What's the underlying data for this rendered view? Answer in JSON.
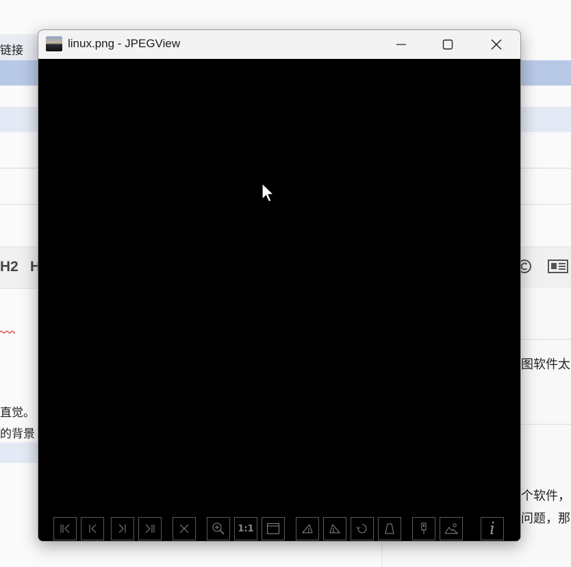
{
  "background_app": {
    "top_left_text": "链接",
    "heading_buttons": [
      "H2",
      "H"
    ],
    "left_text_lines": [
      "直觉。",
      "的背景"
    ],
    "right_text_lines": [
      "图软件太",
      "个软件，",
      "问题，那"
    ],
    "icons": [
      "copyright-icon",
      "newspaper-icon"
    ]
  },
  "viewer": {
    "title": "linux.png - JPEGView",
    "window_controls": {
      "minimize": "minimize-icon",
      "maximize": "maximize-icon",
      "close": "close-icon"
    },
    "toolbar": {
      "groups": [
        [
          {
            "name": "first-image-button",
            "icon": "skip-first-icon"
          },
          {
            "name": "previous-image-button",
            "icon": "previous-icon"
          },
          {
            "name": "next-image-button",
            "icon": "next-icon"
          },
          {
            "name": "last-image-button",
            "icon": "skip-last-icon"
          }
        ],
        [
          {
            "name": "delete-button",
            "icon": "cross-icon"
          }
        ],
        [
          {
            "name": "zoom-button",
            "icon": "zoom-in-icon"
          },
          {
            "name": "actual-size-button",
            "label": "1:1"
          },
          {
            "name": "fit-window-button",
            "icon": "window-icon"
          }
        ],
        [
          {
            "name": "rotate-clockwise-button",
            "icon": "rotate-cw-icon"
          },
          {
            "name": "rotate-counterclockwise-button",
            "icon": "rotate-ccw-icon"
          },
          {
            "name": "rotate-free-button",
            "icon": "rotate-arrow-icon"
          },
          {
            "name": "perspective-button",
            "icon": "trapezoid-icon"
          }
        ],
        [
          {
            "name": "keep-params-button",
            "icon": "pin-icon"
          },
          {
            "name": "landscape-mode-button",
            "icon": "landscape-icon"
          }
        ],
        [
          {
            "name": "info-button",
            "label": "i"
          }
        ]
      ]
    },
    "colors": {
      "titlebar": "#f3f3f3",
      "canvas": "#000000",
      "toolbar_button_border": "#5a5a5a"
    }
  }
}
